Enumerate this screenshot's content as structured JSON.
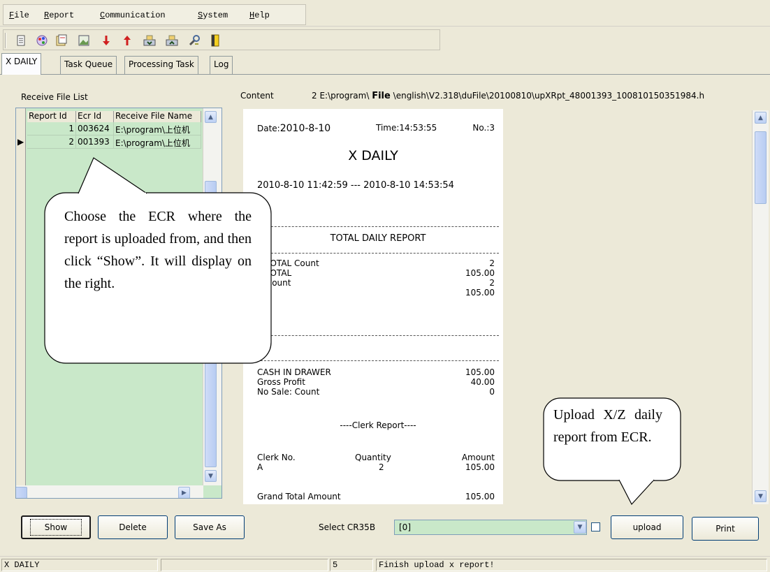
{
  "menu": {
    "file": {
      "mnemonic": "F",
      "rest": "ile"
    },
    "report": {
      "mnemonic": "R",
      "rest": "eport"
    },
    "communication": {
      "mnemonic": "C",
      "rest": "ommunication"
    },
    "system": {
      "mnemonic": "S",
      "rest": "ystem"
    },
    "help": {
      "mnemonic": "H",
      "rest": "elp"
    }
  },
  "toolbar_icons": [
    "document-icon",
    "palette-icon",
    "notes-icon",
    "image-icon",
    "arrow-down-icon",
    "arrow-up-icon",
    "download-data-icon",
    "upload-data-icon",
    "tools-icon",
    "exit-door-icon"
  ],
  "tabs": [
    "X DAILY",
    "Task Queue",
    "Processing Task",
    "Log"
  ],
  "left_panel": {
    "title": "Receive File List",
    "columns": [
      "Report Id",
      "Ecr Id",
      "Receive File Name"
    ],
    "rows": [
      {
        "report_id": "1",
        "ecr_id": "003624",
        "file_name": "E:\\program\\上位机"
      },
      {
        "report_id": "2",
        "ecr_id": "001393",
        "file_name": "E:\\program\\上位机"
      }
    ]
  },
  "right_panel": {
    "content_label": "Content",
    "content_path": "2 E:\\program\\",
    "file_word": "File",
    "content_path_rest": "\\english\\V2.318\\duFile\\20100810\\upXRpt_48001393_100810150351984.h"
  },
  "report": {
    "date_label": "Date:",
    "date": "2010-8-10",
    "time": "Time:14:53:55",
    "no": "No.:3",
    "title": "X DAILY",
    "period": "2010-8-10 11:42:59 --- 2010-8-10 14:53:54",
    "section_title": "TOTAL DAILY REPORT",
    "totals": [
      {
        "label": "T TOTAL Count",
        "value": "2"
      },
      {
        "label": "T TOTAL",
        "value": "105.00"
      },
      {
        "label": "H Count",
        "value": "2"
      },
      {
        "label": "H",
        "value": "105.00"
      }
    ],
    "summary": [
      {
        "label": "CASH IN DRAWER",
        "value": "105.00"
      },
      {
        "label": "Gross Profit",
        "value": "40.00"
      },
      {
        "label": "No Sale: Count",
        "value": "0"
      }
    ],
    "clerk_title": "----Clerk Report----",
    "clerk_headers": {
      "no": "Clerk No.",
      "qty": "Quantity",
      "amount": "Amount"
    },
    "clerk_row": {
      "no": "A",
      "qty": "2",
      "amount": "105.00"
    },
    "grand_total_label": "Grand Total Amount",
    "grand_total_value": "105.00"
  },
  "callouts": {
    "left": "Choose the ECR where the report is uploaded from, and then click “Show”. It will display on the right.",
    "right": "Upload X/Z daily report from ECR."
  },
  "bottom": {
    "show": "Show",
    "delete": "Delete",
    "save_as": "Save As",
    "select_label": "Select CR35B",
    "select_value": "[0]",
    "upload": "upload",
    "print": "Print"
  },
  "status": {
    "mode": "X DAILY",
    "count": "5",
    "message": "Finish upload x report!"
  },
  "colors": {
    "grid_bg": "#c9e8c9",
    "scroll_blue": "#bcd0f4",
    "window_bg": "#ece9d8"
  }
}
